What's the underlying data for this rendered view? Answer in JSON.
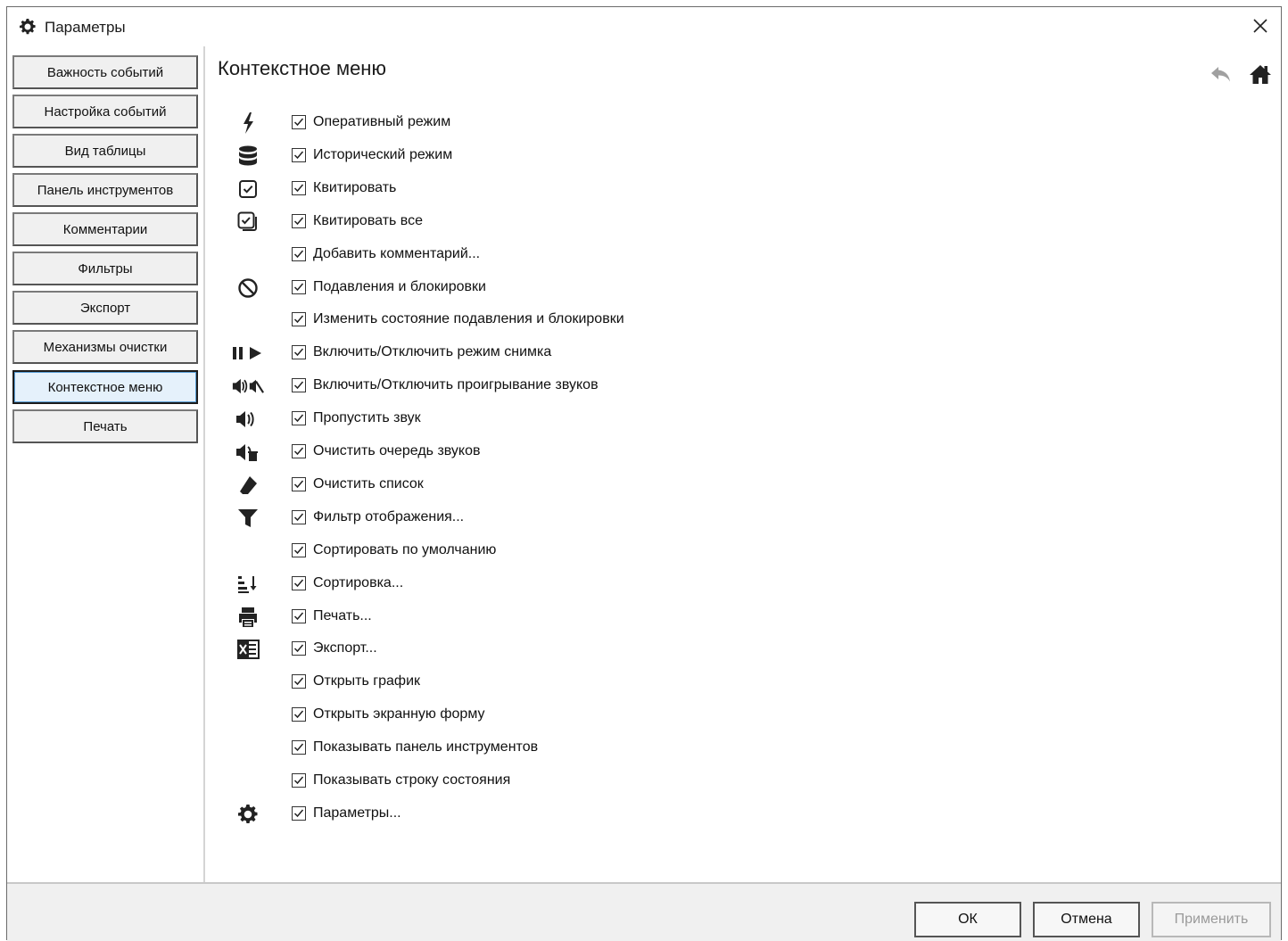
{
  "window": {
    "title": "Параметры",
    "title_icon": "gear-icon",
    "close_icon": "close-icon"
  },
  "sidebar": {
    "items": [
      {
        "label": "Важность событий"
      },
      {
        "label": "Настройка событий"
      },
      {
        "label": "Вид таблицы"
      },
      {
        "label": "Панель инструментов"
      },
      {
        "label": "Комментарии"
      },
      {
        "label": "Фильтры"
      },
      {
        "label": "Экспорт"
      },
      {
        "label": "Механизмы очистки"
      },
      {
        "label": "Контекстное меню",
        "active": true
      },
      {
        "label": "Печать"
      }
    ]
  },
  "main": {
    "title": "Контекстное меню",
    "header_icons": [
      "undo-icon",
      "home-icon"
    ],
    "options": [
      {
        "label": "Оперативный режим",
        "checked": true,
        "icon": "lightning-icon"
      },
      {
        "label": "Исторический режим",
        "checked": true,
        "icon": "database-icon"
      },
      {
        "label": "Квитировать",
        "checked": true,
        "icon": "check-square-icon"
      },
      {
        "label": "Квитировать все",
        "checked": true,
        "icon": "check-all-icon"
      },
      {
        "label": "Добавить комментарий...",
        "checked": true,
        "icon": ""
      },
      {
        "label": "Подавления и блокировки",
        "checked": true,
        "icon": "ban-icon"
      },
      {
        "label": "Изменить состояние подавления и блокировки",
        "checked": true,
        "icon": ""
      },
      {
        "label": "Включить/Отключить режим снимка",
        "checked": true,
        "icon": "pause-play-icon"
      },
      {
        "label": "Включить/Отключить проигрывание звуков",
        "checked": true,
        "icon": "sound-toggle-icon"
      },
      {
        "label": "Пропустить звук",
        "checked": true,
        "icon": "sound-skip-icon"
      },
      {
        "label": "Очистить очередь звуков",
        "checked": true,
        "icon": "sound-clear-icon"
      },
      {
        "label": "Очистить список",
        "checked": true,
        "icon": "eraser-icon"
      },
      {
        "label": "Фильтр отображения...",
        "checked": true,
        "icon": "filter-icon"
      },
      {
        "label": "Сортировать по умолчанию",
        "checked": true,
        "icon": ""
      },
      {
        "label": "Сортировка...",
        "checked": true,
        "icon": "sort-icon"
      },
      {
        "label": "Печать...",
        "checked": true,
        "icon": "print-icon"
      },
      {
        "label": "Экспорт...",
        "checked": true,
        "icon": "excel-icon"
      },
      {
        "label": "Открыть график",
        "checked": true,
        "icon": ""
      },
      {
        "label": "Открыть экранную форму",
        "checked": true,
        "icon": ""
      },
      {
        "label": "Показывать панель инструментов",
        "checked": true,
        "icon": ""
      },
      {
        "label": "Показывать строку состояния",
        "checked": true,
        "icon": ""
      },
      {
        "label": "Параметры...",
        "checked": true,
        "icon": "gear-icon"
      }
    ]
  },
  "footer": {
    "ok": "ОК",
    "cancel": "Отмена",
    "apply": "Применить"
  }
}
